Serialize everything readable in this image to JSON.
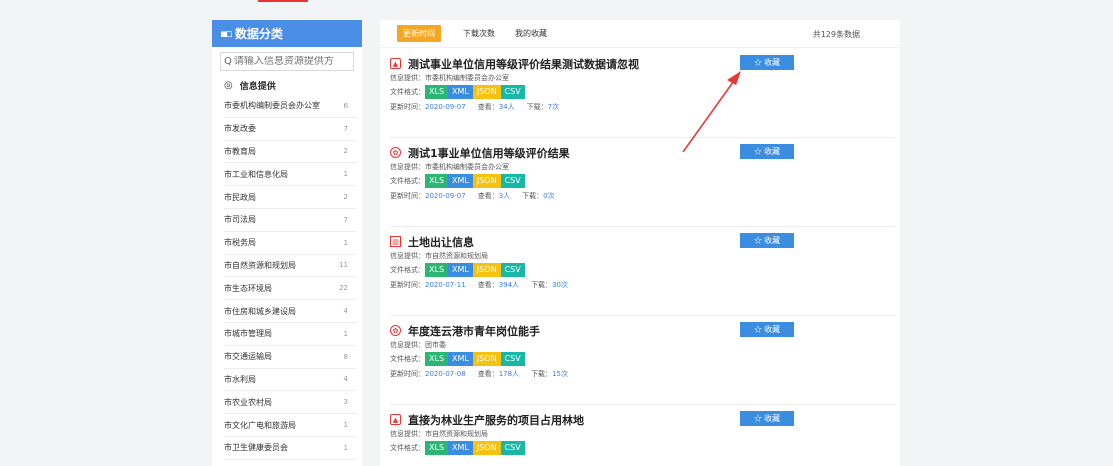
{
  "sidebar": {
    "header": "数据分类",
    "search_placeholder": "请输入信息资源提供方",
    "subheader": "信息提供",
    "items": [
      {
        "label": "市委机构编制委员会办公室",
        "count": "6"
      },
      {
        "label": "市发改委",
        "count": "7"
      },
      {
        "label": "市教育局",
        "count": "2"
      },
      {
        "label": "市工业和信息化局",
        "count": "1"
      },
      {
        "label": "市民政局",
        "count": "2"
      },
      {
        "label": "市司法局",
        "count": "7"
      },
      {
        "label": "市税务局",
        "count": "1"
      },
      {
        "label": "市自然资源和规划局",
        "count": "11"
      },
      {
        "label": "市生态环境局",
        "count": "22"
      },
      {
        "label": "市住房和城乡建设局",
        "count": "4"
      },
      {
        "label": "市城市管理局",
        "count": "1"
      },
      {
        "label": "市交通运输局",
        "count": "8"
      },
      {
        "label": "市水利局",
        "count": "4"
      },
      {
        "label": "市农业农村局",
        "count": "3"
      },
      {
        "label": "市文化广电和旅游局",
        "count": "1"
      },
      {
        "label": "市卫生健康委员会",
        "count": "1"
      }
    ]
  },
  "tabs": [
    {
      "label": "更新时间",
      "active": true
    },
    {
      "label": "下载次数",
      "active": false
    },
    {
      "label": "我的收藏",
      "active": false
    }
  ],
  "total": "共129条数据",
  "labels": {
    "provider": "信息提供：",
    "format": "文件格式：",
    "update": "更新时间：",
    "views": "查看：",
    "downloads": "下载：",
    "collect": "☆ 收藏"
  },
  "formats": [
    "XLS",
    "XML",
    "JSON",
    "CSV"
  ],
  "items": [
    {
      "icon": "document-icon",
      "title": "测试事业单位信用等级评价结果测试数据请忽视",
      "provider": "市委机构编制委员会办公室",
      "date": "2020-09-07",
      "views": "34人",
      "downloads": "7次"
    },
    {
      "icon": "medal-icon",
      "title": "测试1事业单位信用等级评价结果",
      "provider": "市委机构编制委员会办公室",
      "date": "2020-09-07",
      "views": "3人",
      "downloads": "0次"
    },
    {
      "icon": "building-icon",
      "title": "土地出让信息",
      "provider": "市自然资源和规划局",
      "date": "2020-07-11",
      "views": "394人",
      "downloads": "30次"
    },
    {
      "icon": "medal-icon",
      "title": "年度连云港市青年岗位能手",
      "provider": "团市委",
      "date": "2020-07-08",
      "views": "178人",
      "downloads": "15次"
    },
    {
      "icon": "document-icon",
      "title": "直接为林业生产服务的项目占用林地",
      "provider": "市自然资源和规划局",
      "date": "",
      "views": "",
      "downloads": ""
    }
  ],
  "colors": {
    "accent": "#4a8ee8",
    "active_tab": "#f5a623",
    "xls": "#2bb673",
    "xml": "#3b8de0",
    "json": "#f5c211",
    "csv": "#19b7a5",
    "arrow": "#e53935"
  }
}
